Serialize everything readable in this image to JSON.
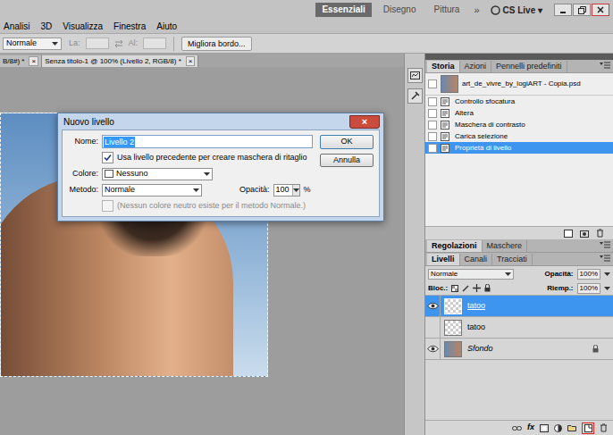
{
  "app_bar": {
    "workspaces": [
      {
        "label": "Essenziali",
        "selected": true
      },
      {
        "label": "Disegno",
        "selected": false
      },
      {
        "label": "Pittura",
        "selected": false
      }
    ],
    "more": "»",
    "cs_live": "CS Live ▾"
  },
  "menu": [
    "Analisi",
    "3D",
    "Visualizza",
    "Finestra",
    "Aiuto"
  ],
  "options_bar": {
    "mode": "Normale",
    "width_label": "La:",
    "height_label": "Al:",
    "refine_button": "Migliora bordo..."
  },
  "doc_tabs": [
    {
      "label": "B/8#) *",
      "selected": false,
      "close": "×"
    },
    {
      "label": "Senza titolo-1 @ 100% (Livello 2, RGB/8) *",
      "selected": true,
      "close": "×"
    }
  ],
  "dialog": {
    "title": "Nuovo livello",
    "close": "×",
    "name_label": "Nome:",
    "name_value": "Livello 2",
    "name_selected": true,
    "clip_checkbox": {
      "label": "Usa livello precedente per creare maschera di ritaglio",
      "checked": true,
      "disabled": false
    },
    "color_label": "Colore:",
    "color_value": "Nessuno",
    "mode_label": "Metodo:",
    "mode_value": "Normale",
    "opacity_label": "Opacità:",
    "opacity_value": "100",
    "opacity_unit": "%",
    "neutral_checkbox": {
      "label": "(Nessun colore neutro esiste per il metodo Normale.)",
      "checked": false,
      "disabled": true
    },
    "buttons": [
      {
        "label": "OK",
        "default": true
      },
      {
        "label": "Annulla",
        "default": false
      }
    ]
  },
  "history_panel": {
    "tabs": [
      {
        "label": "Storia",
        "selected": true
      },
      {
        "label": "Azioni",
        "selected": false
      },
      {
        "label": "Pennelli predefiniti",
        "selected": false
      }
    ],
    "snapshot": "art_de_vivre_by_logiART - Copia.psd",
    "items": [
      {
        "label": "Controllo sfocatura",
        "selected": false
      },
      {
        "label": "Altera",
        "selected": false
      },
      {
        "label": "Maschera di contrasto",
        "selected": false
      },
      {
        "label": "Carica selezione",
        "selected": false
      },
      {
        "label": "Proprietà di livello",
        "selected": true
      }
    ]
  },
  "adjustments_panel": {
    "tabs": [
      {
        "label": "Regolazioni",
        "selected": true
      },
      {
        "label": "Maschere",
        "selected": false
      }
    ]
  },
  "layers_panel": {
    "tabs": [
      {
        "label": "Livelli",
        "selected": true
      },
      {
        "label": "Canali",
        "selected": false
      },
      {
        "label": "Tracciati",
        "selected": false
      }
    ],
    "blend_mode": "Normale",
    "opacity_label": "Opacità:",
    "opacity_value": "100%",
    "lock_label": "Bloc.:",
    "fill_label": "Riemp.:",
    "fill_value": "100%",
    "layers": [
      {
        "name": "tatoo",
        "visible": true,
        "selected": true,
        "locked": false,
        "italic": false
      },
      {
        "name": "tatoo",
        "visible": false,
        "selected": false,
        "locked": false,
        "italic": false
      },
      {
        "name": "Sfondo",
        "visible": true,
        "selected": false,
        "locked": true,
        "italic": true
      }
    ],
    "footer": {
      "fx_label": "fx",
      "new_layer_highlighted": true
    }
  }
}
